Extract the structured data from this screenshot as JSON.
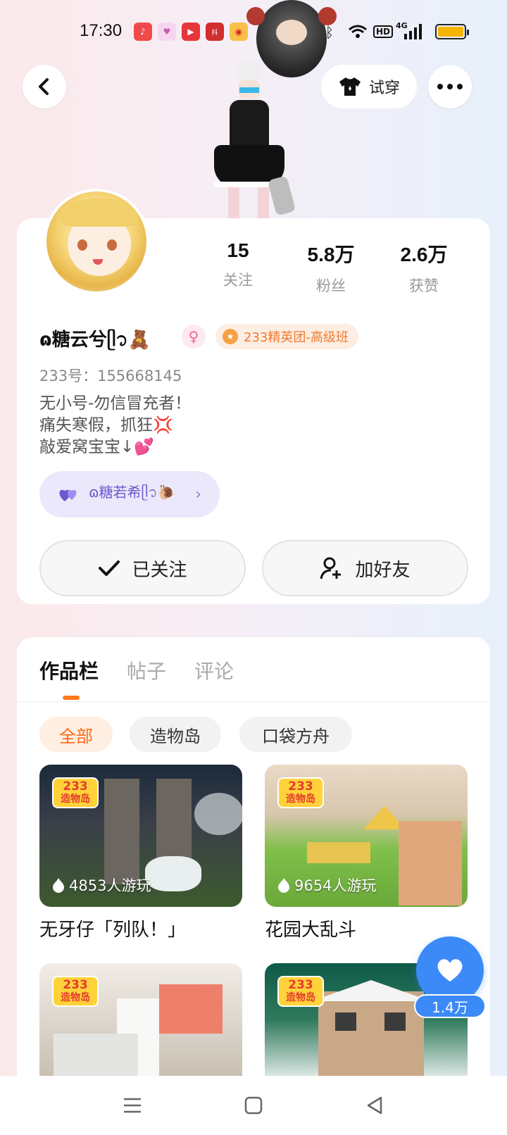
{
  "status_bar": {
    "time": "17:30",
    "network": "4G",
    "hd": "HD"
  },
  "header": {
    "try_on_label": "试穿"
  },
  "profile": {
    "stats": [
      {
        "value": "15",
        "label": "关注"
      },
      {
        "value": "5.8万",
        "label": "粉丝"
      },
      {
        "value": "2.6万",
        "label": "获赞"
      }
    ],
    "username": "ɷ糖云兮ᥫ᭡🧸",
    "elite_badge": "233精英团-高级班",
    "uid": "233号：155668145",
    "bio": [
      "无小号-勿信冒充者！",
      "痛失寒假，抓狂💢",
      "敲爱窝宝宝↓💕"
    ],
    "relation_name": "ɷ糖若希ᥫ᭡🐌"
  },
  "actions": {
    "followed_label": "已关注",
    "add_friend_label": "加好友"
  },
  "tabs": [
    "作品栏",
    "帖子",
    "评论"
  ],
  "filters": [
    "全部",
    "造物岛",
    "口袋方舟"
  ],
  "works": [
    {
      "title": "无牙仔「列队！」",
      "plays": "4853人游玩",
      "logo": [
        "233",
        "造物岛"
      ]
    },
    {
      "title": "花园大乱斗",
      "plays": "9654人游玩",
      "logo": [
        "233",
        "造物岛"
      ]
    },
    {
      "title": "",
      "plays": "",
      "logo": [
        "233",
        "造物岛"
      ]
    },
    {
      "title": "",
      "plays": "",
      "logo": [
        "233",
        "造物岛"
      ]
    }
  ],
  "like_count": "1.4万",
  "colors": {
    "accent_orange": "#ff7a1a",
    "like_blue": "#3b8af7",
    "relation_purple": "#6a5acd"
  }
}
